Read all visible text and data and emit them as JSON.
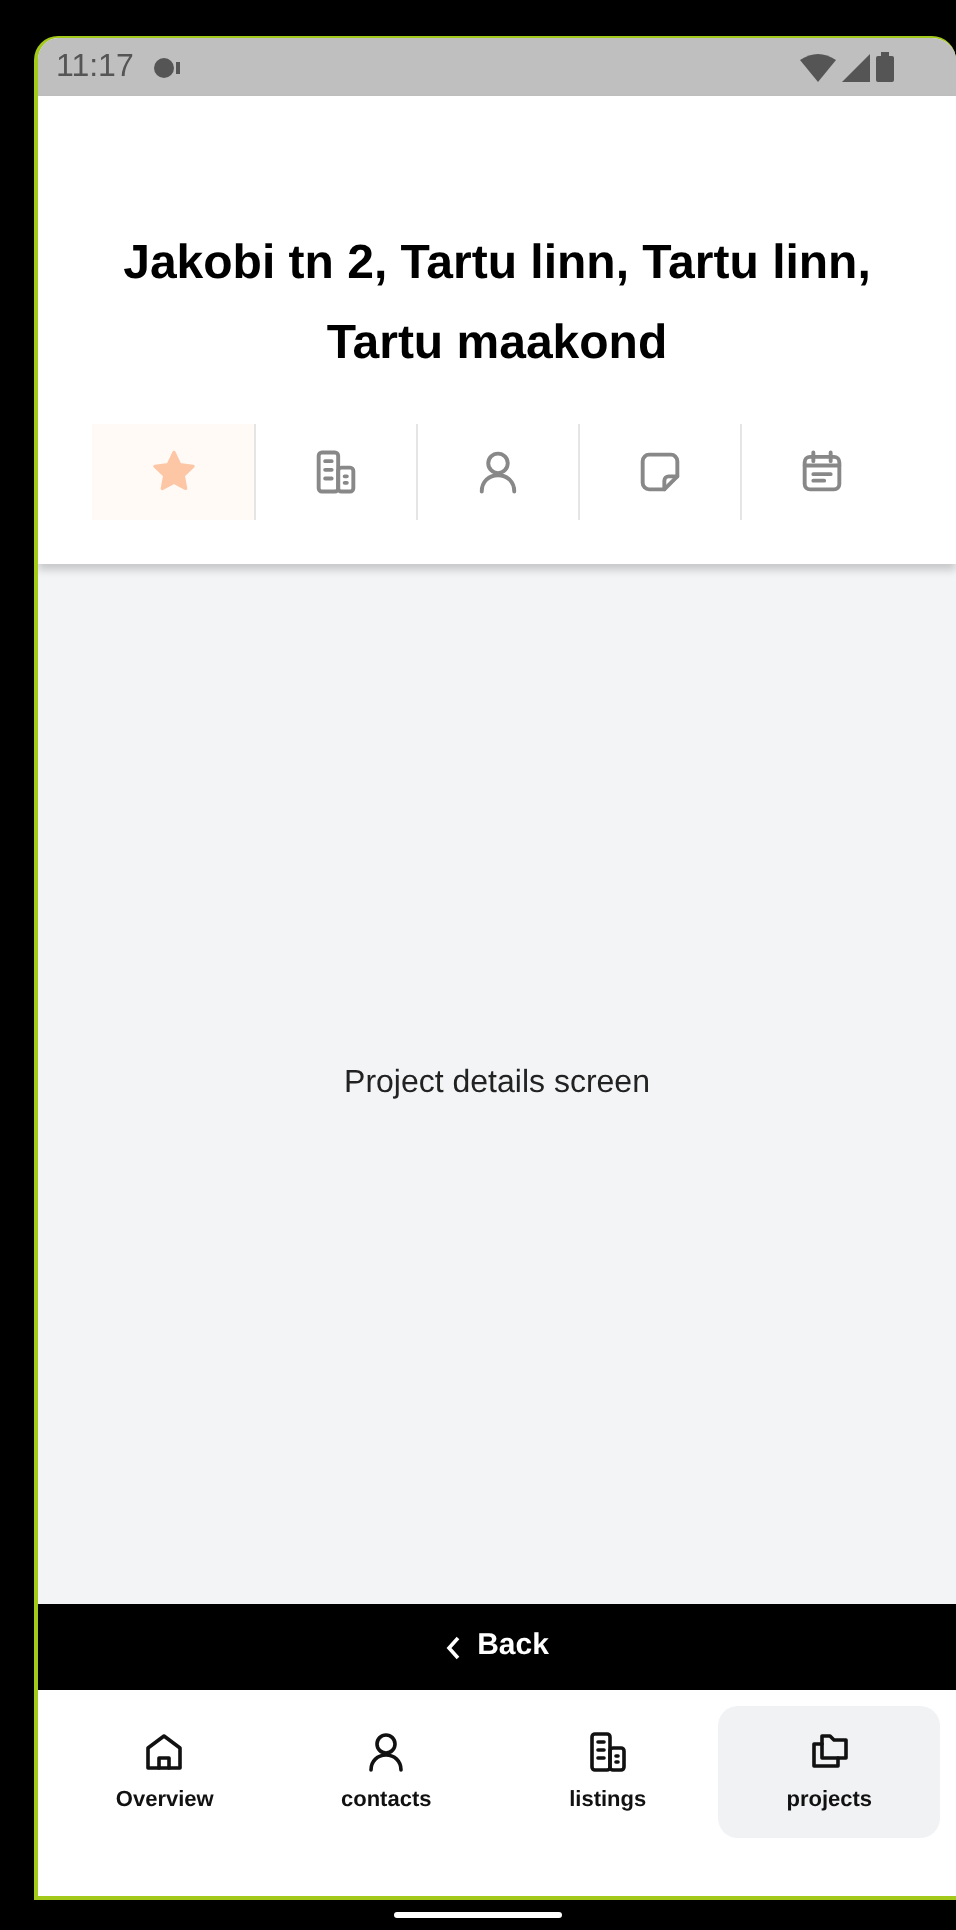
{
  "status_bar": {
    "time": "11:17"
  },
  "header": {
    "title": "Jakobi tn 2, Tartu linn, Tartu linn, Tartu maakond"
  },
  "tabs": [
    {
      "kind": "star",
      "selected": true
    },
    {
      "kind": "building",
      "selected": false
    },
    {
      "kind": "person",
      "selected": false
    },
    {
      "kind": "note",
      "selected": false
    },
    {
      "kind": "calendar",
      "selected": false
    }
  ],
  "content": {
    "text": "Project details screen"
  },
  "back_button": {
    "label": "Back"
  },
  "bottom_nav": [
    {
      "kind": "home",
      "label": "Overview",
      "selected": false
    },
    {
      "kind": "person",
      "label": "contacts",
      "selected": false
    },
    {
      "kind": "building",
      "label": "listings",
      "selected": false
    },
    {
      "kind": "folders",
      "label": "projects",
      "selected": true
    }
  ]
}
